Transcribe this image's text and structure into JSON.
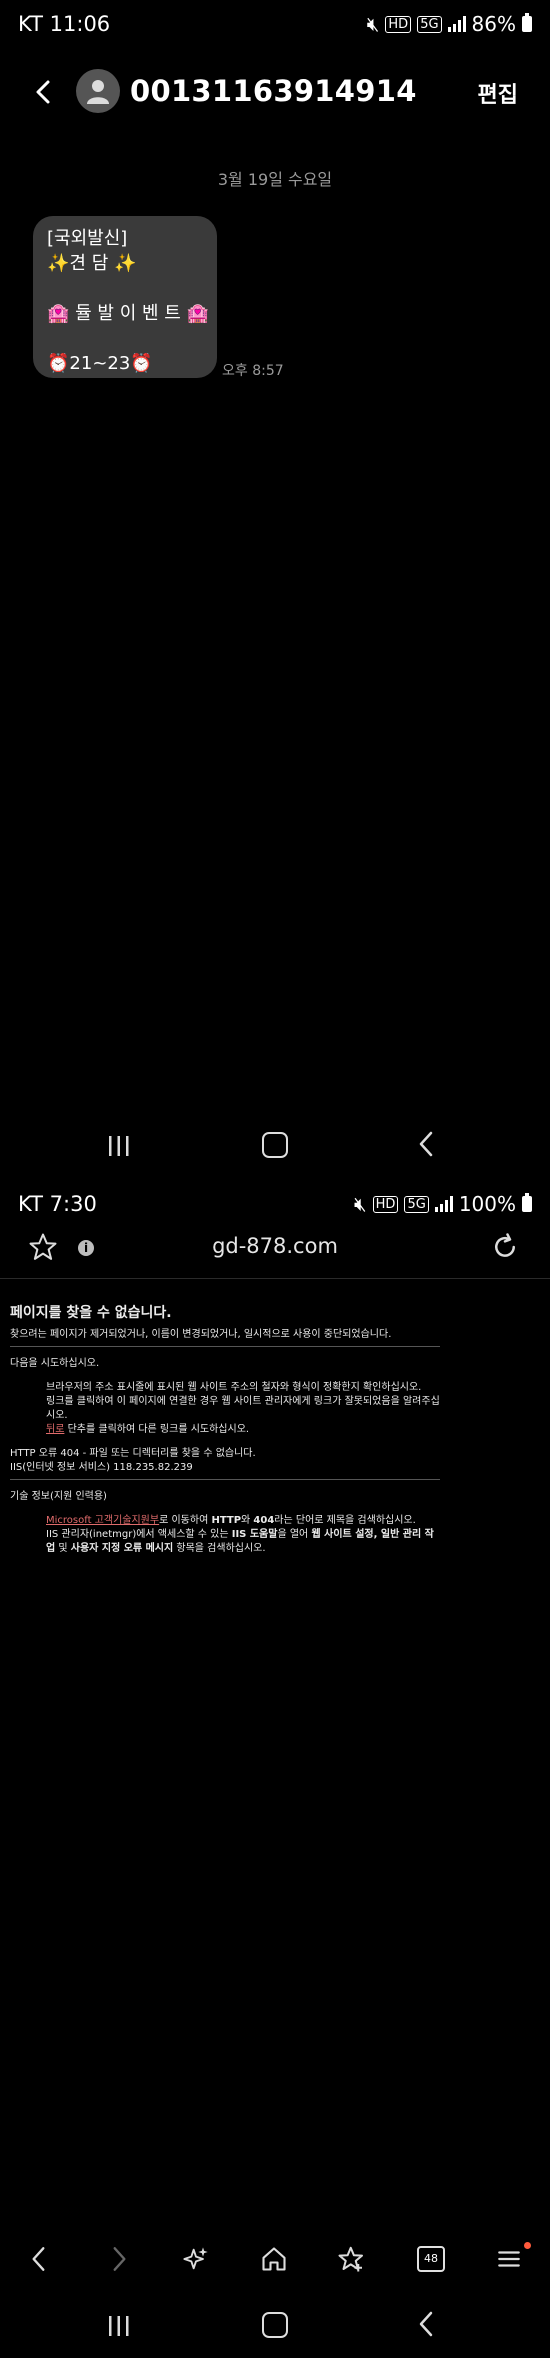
{
  "screen1": {
    "status": {
      "carrier": "KT 11:06",
      "hd": "HD",
      "net": "5G",
      "battery": "86%"
    },
    "header": {
      "phone_number": "00131163914914",
      "edit_label": "편집"
    },
    "conversation": {
      "date": "3월 19일 수요일",
      "message_lines": [
        "[국외발신]",
        "✨견 담 ✨",
        "",
        "🏩 듈 발 이 벤 트 🏩",
        "",
        "⏰21~23⏰"
      ],
      "time": "오후 8:57"
    }
  },
  "screen2": {
    "status": {
      "carrier": "KT 7:30",
      "hd": "HD",
      "net": "5G",
      "battery": "100%"
    },
    "browser": {
      "url": "gd-878.com",
      "tab_count": "48"
    },
    "error_page": {
      "title": "페이지를 찾을 수 없습니다.",
      "subtitle": "찾으려는 페이지가 제거되었거나, 이름이 변경되었거나, 일시적으로 사용이 중단되었습니다.",
      "try_heading": "다음을 시도하십시오.",
      "try_line1": "브라우저의 주소 표시줄에 표시된 웹 사이트 주소의 철자와 형식이 정확한지 확인하십시오.",
      "try_line2": "링크를 클릭하여 이 페이지에 연결한 경우 웹 사이트 관리자에게 링크가 잘못되었음을 알려주십시오.",
      "back_link": "뒤로",
      "back_rest": " 단추를 클릭하여 다른 링크를 시도하십시오.",
      "http_error": "HTTP 오류 404 - 파일 또는 디렉터리를 찾을 수 없습니다.",
      "iis_line": "IIS(인터넷 정보 서비스) 118.235.82.239",
      "tech_heading": "기술 정보(지원 인력용)",
      "ms_link": "Microsoft 고객기술지원부",
      "ms_rest1": "로 이동하여 ",
      "ms_bold1": "HTTP",
      "ms_rest2": "와 ",
      "ms_bold2": "404",
      "ms_rest3": "라는 단어로 제목을 검색하십시오.",
      "iis_mgr1": "IIS 관리자(inetmgr)에서 액세스할 수 있는 ",
      "iis_mgr_bold1": "IIS 도움말",
      "iis_mgr2": "을 열어 ",
      "iis_mgr_bold2": "웹 사이트 설정, 일반 관리 작업",
      "iis_mgr3": " 및 ",
      "iis_mgr_bold3": "사용자 지정 오류 메시지",
      "iis_mgr4": " 항목을 검색하십시오."
    }
  }
}
